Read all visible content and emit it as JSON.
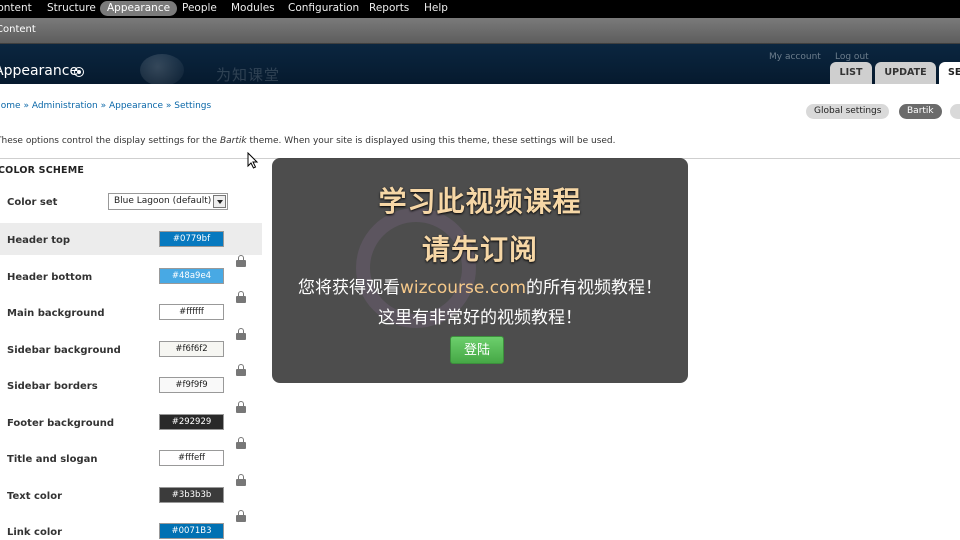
{
  "toolbar": {
    "items": [
      {
        "label": "Content"
      },
      {
        "label": "Structure"
      },
      {
        "label": "Appearance"
      },
      {
        "label": "People"
      },
      {
        "label": "Modules"
      },
      {
        "label": "Configuration"
      },
      {
        "label": "Reports"
      },
      {
        "label": "Help"
      }
    ]
  },
  "shortcuts": {
    "label": "Content"
  },
  "header": {
    "title": "Appearance",
    "watermark": "为知课堂",
    "my_account": "My account",
    "log_out": "Log out",
    "tabs": [
      {
        "label": "LIST"
      },
      {
        "label": "UPDATE"
      },
      {
        "label": "SE"
      }
    ]
  },
  "breadcrumb": {
    "items": [
      "Home",
      "Administration",
      "Appearance",
      "Settings"
    ],
    "separator": "»"
  },
  "secondary_tabs": [
    {
      "label": "Global settings"
    },
    {
      "label": "Bartik"
    }
  ],
  "intro": {
    "before": "These options control the display settings for the ",
    "theme": "Bartik",
    "after": " theme. When your site is displayed using this theme, these settings will be used."
  },
  "color_scheme": {
    "title": "COLOR SCHEME",
    "color_set_label": "Color set",
    "color_set_value": "Blue Lagoon (default)",
    "fields": [
      {
        "label": "Header top",
        "value": "#0779bf",
        "color": "#0779bf",
        "text_color": "#ffffff"
      },
      {
        "label": "Header bottom",
        "value": "#48a9e4",
        "color": "#48a9e4",
        "text_color": "#ffffff"
      },
      {
        "label": "Main background",
        "value": "#ffffff",
        "color": "#ffffff",
        "text_color": "#222222"
      },
      {
        "label": "Sidebar background",
        "value": "#f6f6f2",
        "color": "#f6f6f2",
        "text_color": "#222222"
      },
      {
        "label": "Sidebar borders",
        "value": "#f9f9f9",
        "color": "#f9f9f9",
        "text_color": "#222222"
      },
      {
        "label": "Footer background",
        "value": "#292929",
        "color": "#292929",
        "text_color": "#ffffff"
      },
      {
        "label": "Title and slogan",
        "value": "#fffeff",
        "color": "#fffeff",
        "text_color": "#222222"
      },
      {
        "label": "Text color",
        "value": "#3b3b3b",
        "color": "#3b3b3b",
        "text_color": "#ffffff"
      },
      {
        "label": "Link color",
        "value": "#0071B3",
        "color": "#0071B3",
        "text_color": "#ffffff"
      }
    ]
  },
  "overlay": {
    "line1": "学习此视频课程",
    "line2": "请先订阅",
    "line3_before": "您将获得观看",
    "line3_link": "wizcourse.com",
    "line3_after": "的所有视频教程！",
    "line4": "这里有非常好的视频教程！",
    "button": "登陆"
  }
}
